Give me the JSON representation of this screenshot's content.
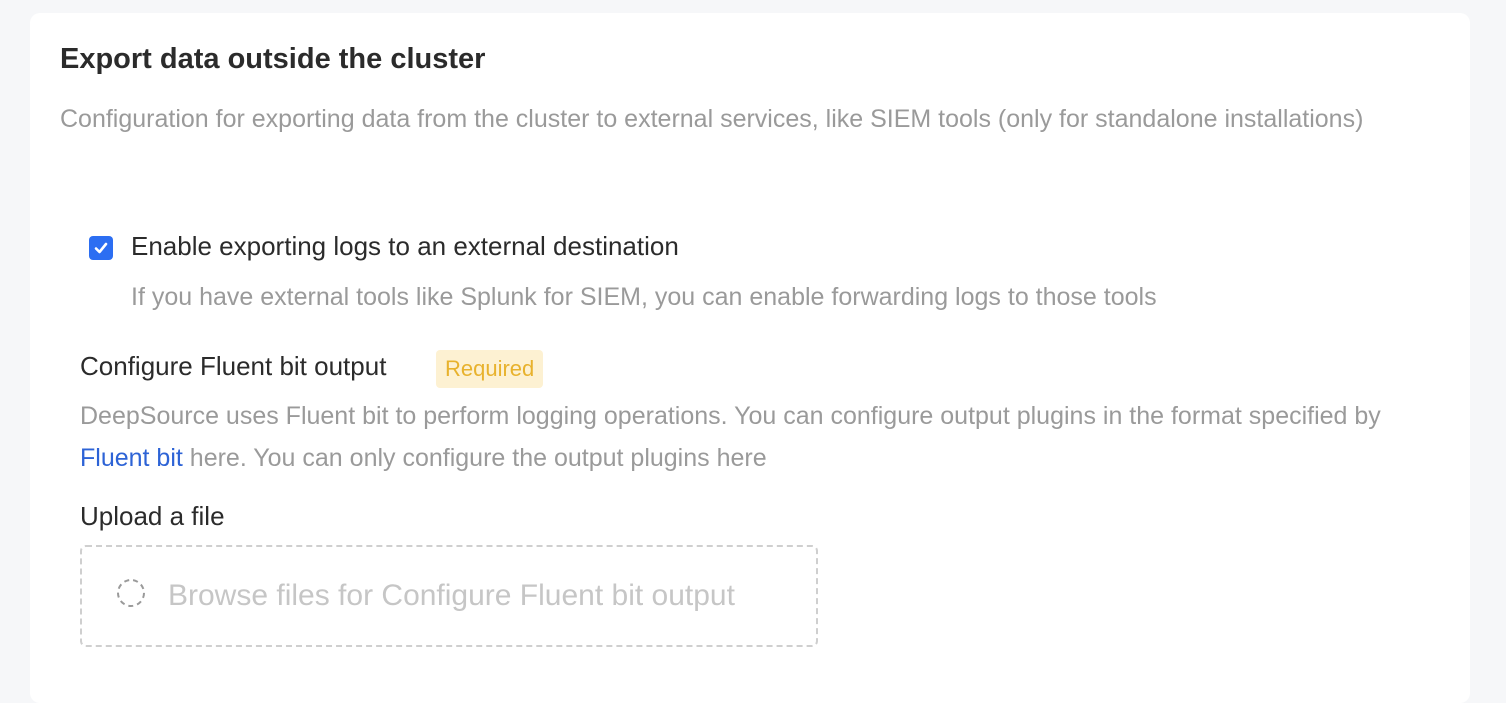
{
  "section": {
    "title": "Export data outside the cluster",
    "description": "Configuration for exporting data from the cluster to external services, like SIEM tools (only for standalone installations)"
  },
  "export_logs": {
    "checked": true,
    "label": "Enable exporting logs to an external destination",
    "hint": "If you have external tools like Splunk for SIEM, you can enable forwarding logs to those tools"
  },
  "fluent_bit": {
    "title": "Configure Fluent bit output",
    "badge": "Required",
    "description_before": "DeepSource uses Fluent bit to perform logging operations. You can configure output plugins in the format specified by",
    "link_text": "Fluent bit",
    "description_after": "here. You can only configure the output plugins here"
  },
  "upload": {
    "label": "Upload a file",
    "dropzone_text": "Browse files for Configure Fluent bit output",
    "icon": "dashed-circle-icon"
  },
  "colors": {
    "checkbox": "#2c6ef2",
    "link": "#2d63d6",
    "badge_bg": "#fdf1d2",
    "badge_text": "#e8b22d"
  }
}
